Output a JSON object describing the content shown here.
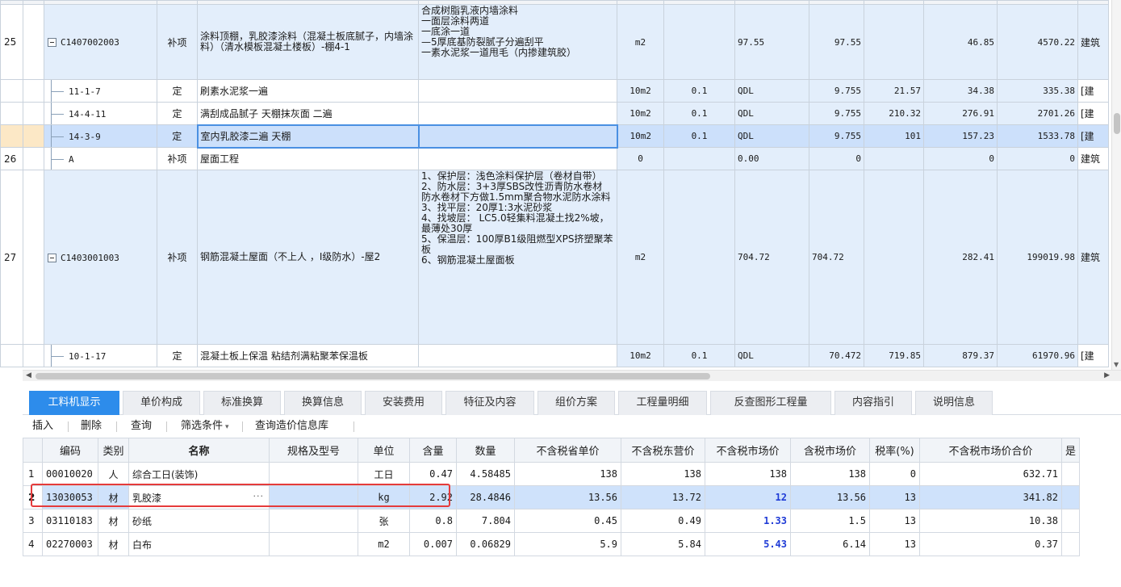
{
  "top_table": {
    "rows": [
      {
        "row_num": "25",
        "code": "C1407002003",
        "type": "补项",
        "name": "涂料顶棚，乳胶漆涂料（混凝土板底腻子，内墙涂料）（清水模板混凝土楼板）-棚4-1",
        "features": "合成树脂乳液内墙涂料\n  一面层涂料两道\n一底涂一道\n—5厚底基防裂腻子分遍刮平\n一素水泥浆一道甩毛（内掺建筑胶）",
        "unit": "m2",
        "coef": "",
        "qty_expr": "97.55",
        "qty": "97.55",
        "price1": "",
        "price2": "46.85",
        "total": "4570.22",
        "spec": "建筑"
      },
      {
        "row_num": "",
        "code": "11-1-7",
        "type": "定",
        "name": "刷素水泥浆一遍",
        "features": "",
        "unit": "10m2",
        "coef": "0.1",
        "qty_expr": "QDL",
        "qty": "9.755",
        "price1": "21.57",
        "price2": "34.38",
        "total": "335.38",
        "spec": "[建"
      },
      {
        "row_num": "",
        "code": "14-4-11",
        "type": "定",
        "name": "满刮成品腻子 天棚抹灰面 二遍",
        "features": "",
        "unit": "10m2",
        "coef": "0.1",
        "qty_expr": "QDL",
        "qty": "9.755",
        "price1": "210.32",
        "price2": "276.91",
        "total": "2701.26",
        "spec": "[建"
      },
      {
        "row_num": "",
        "code": "14-3-9",
        "type": "定",
        "name": "室内乳胶漆二遍 天棚",
        "features": "",
        "unit": "10m2",
        "coef": "0.1",
        "qty_expr": "QDL",
        "qty": "9.755",
        "price1": "101",
        "price2": "157.23",
        "total": "1533.78",
        "spec": "[建"
      },
      {
        "row_num": "26",
        "code": "A",
        "type": "补项",
        "name": "屋面工程",
        "features": "",
        "unit": "0",
        "coef": "",
        "qty_expr": "0.00",
        "qty": "0",
        "price1": "",
        "price2": "0",
        "total": "0",
        "spec": "建筑"
      },
      {
        "row_num": "27",
        "code": "C1403001003",
        "type": "补项",
        "name": "钢筋混凝土屋面（不上人 ，I级防水）-屋2",
        "features": "1、保护层：浅色涂料保护层（卷材自带）\n2、防水层：3+3厚SBS改性沥青防水卷材\n        防水卷材下方做1.5mm聚合物水泥防水涂料\n3、找平层：20厚1:3水泥砂浆\n4、找坡层： LC5.0轻集料混凝土找2%坡，最薄处30厚\n5、保温层：100厚B1级阻燃型XPS挤塑聚苯板\n6、钢筋混凝土屋面板",
        "unit": "m2",
        "coef": "",
        "qty_expr": "704.72",
        "qty": "704.72",
        "price1": "",
        "price2": "282.41",
        "total": "199019.98",
        "spec": "建筑"
      },
      {
        "row_num": "",
        "code": "10-1-17",
        "type": "定",
        "name": "混凝土板上保温 粘结剂满粘聚苯保温板",
        "features": "",
        "unit": "10m2",
        "coef": "0.1",
        "qty_expr": "QDL",
        "qty": "70.472",
        "price1": "719.85",
        "price2": "879.37",
        "total": "61970.96",
        "spec": "[建"
      }
    ]
  },
  "tabs": [
    "工料机显示",
    "单价构成",
    "标准换算",
    "换算信息",
    "安装费用",
    "特征及内容",
    "组价方案",
    "工程量明细",
    "反查图形工程量",
    "内容指引",
    "说明信息"
  ],
  "toolbar": {
    "insert": "插入",
    "delete": "删除",
    "query": "查询",
    "filter": "筛选条件",
    "query_price": "查询造价信息库"
  },
  "resource_table": {
    "headers": [
      "编码",
      "类别",
      "名称",
      "规格及型号",
      "单位",
      "含量",
      "数量",
      "不含税省单价",
      "不含税东营价",
      "不含税市场价",
      "含税市场价",
      "税率(%)",
      "不含税市场价合价",
      "是"
    ],
    "rows": [
      [
        "1",
        "00010020",
        "人",
        "综合工日(装饰)",
        "",
        "工日",
        "0.47",
        "4.58485",
        "138",
        "138",
        "138",
        "138",
        "0",
        "632.71"
      ],
      [
        "2",
        "13030053",
        "材",
        "乳胶漆",
        "",
        "kg",
        "2.92",
        "28.4846",
        "13.56",
        "13.72",
        "12",
        "13.56",
        "13",
        "341.82"
      ],
      [
        "3",
        "03110183",
        "材",
        "砂纸",
        "",
        "张",
        "0.8",
        "7.804",
        "0.45",
        "0.49",
        "1.33",
        "1.5",
        "13",
        "10.38"
      ],
      [
        "4",
        "02270003",
        "材",
        "白布",
        "",
        "m2",
        "0.007",
        "0.06829",
        "5.9",
        "5.84",
        "5.43",
        "6.14",
        "13",
        "0.37"
      ]
    ]
  },
  "colors": {
    "accent": "#2d8ceb",
    "row_highlight": "#cfe2fb",
    "market_price_blue": "#1f3bd6",
    "annotation_red": "#e53b3b"
  }
}
